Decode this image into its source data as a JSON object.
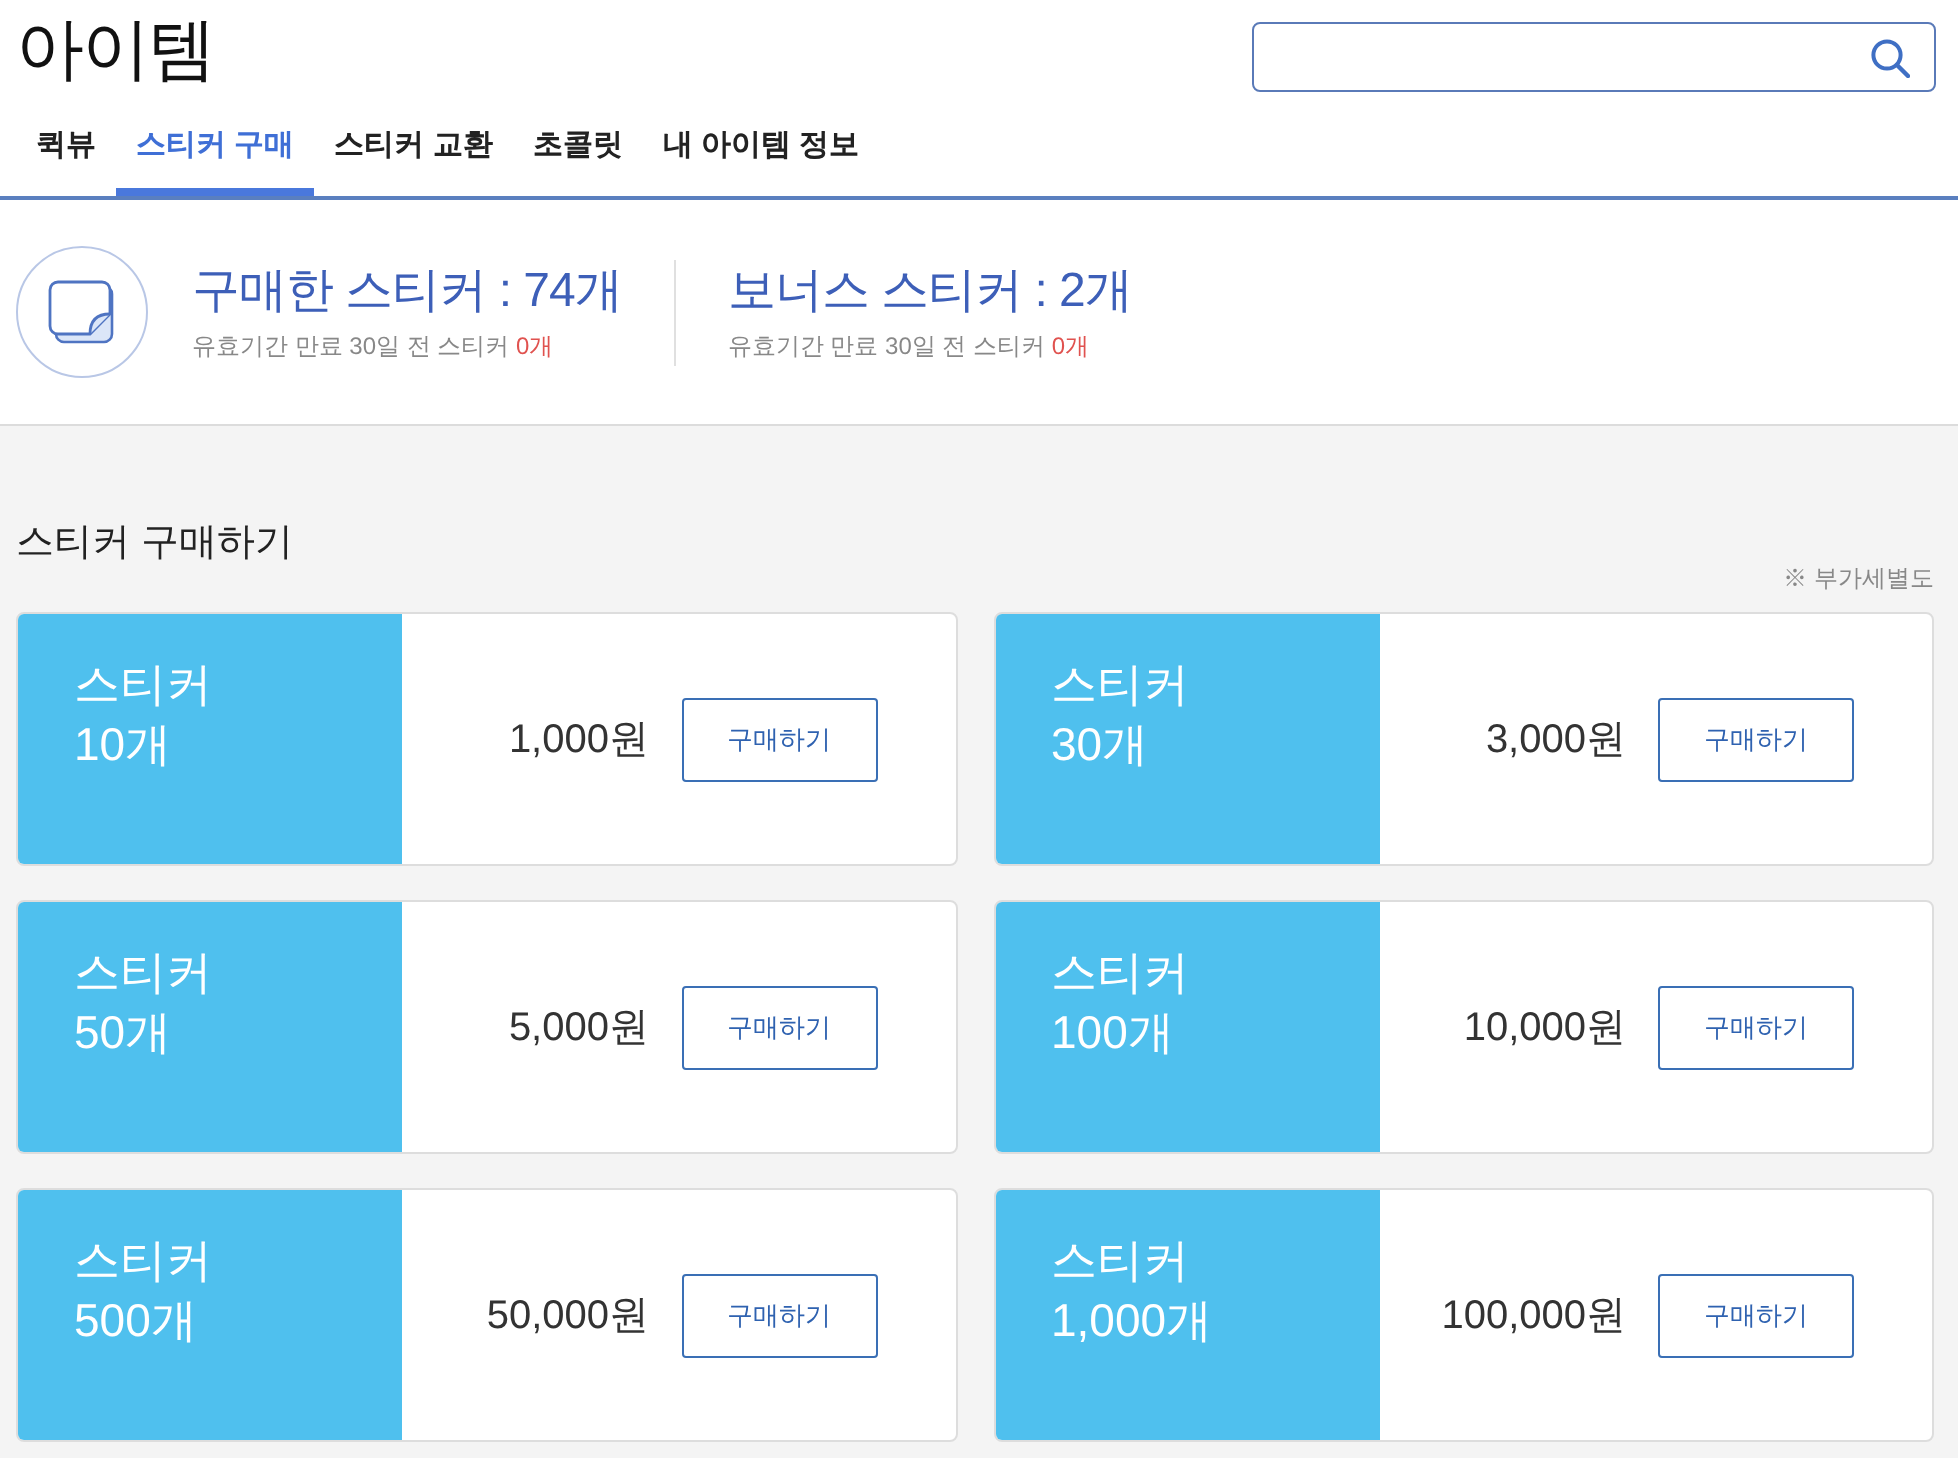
{
  "page": {
    "title": "아이템"
  },
  "tabs": [
    {
      "label": "퀵뷰",
      "selected": false
    },
    {
      "label": "스티커 구매",
      "selected": true
    },
    {
      "label": "스티커 교환",
      "selected": false
    },
    {
      "label": "초콜릿",
      "selected": false
    },
    {
      "label": "내 아이템 정보",
      "selected": false
    }
  ],
  "summary": [
    {
      "title": "구매한 스티커 : 74개",
      "note": "유효기간 만료 30일 전 스티커",
      "expiring": "0개"
    },
    {
      "title": "보너스 스티커 : 2개",
      "note": "유효기간 만료 30일 전 스티커",
      "expiring": "0개"
    }
  ],
  "purchase": {
    "heading": "스티커 구매하기",
    "vat_note": "※ 부가세별도",
    "packages": [
      {
        "name": "스티커",
        "quantity": "10개",
        "price": "1,000원",
        "button": "구매하기"
      },
      {
        "name": "스티커",
        "quantity": "30개",
        "price": "3,000원",
        "button": "구매하기"
      },
      {
        "name": "스티커",
        "quantity": "50개",
        "price": "5,000원",
        "button": "구매하기"
      },
      {
        "name": "스티커",
        "quantity": "100개",
        "price": "10,000원",
        "button": "구매하기"
      },
      {
        "name": "스티커",
        "quantity": "500개",
        "price": "50,000원",
        "button": "구매하기"
      },
      {
        "name": "스티커",
        "quantity": "1,000개",
        "price": "100,000원",
        "button": "구매하기"
      }
    ]
  }
}
